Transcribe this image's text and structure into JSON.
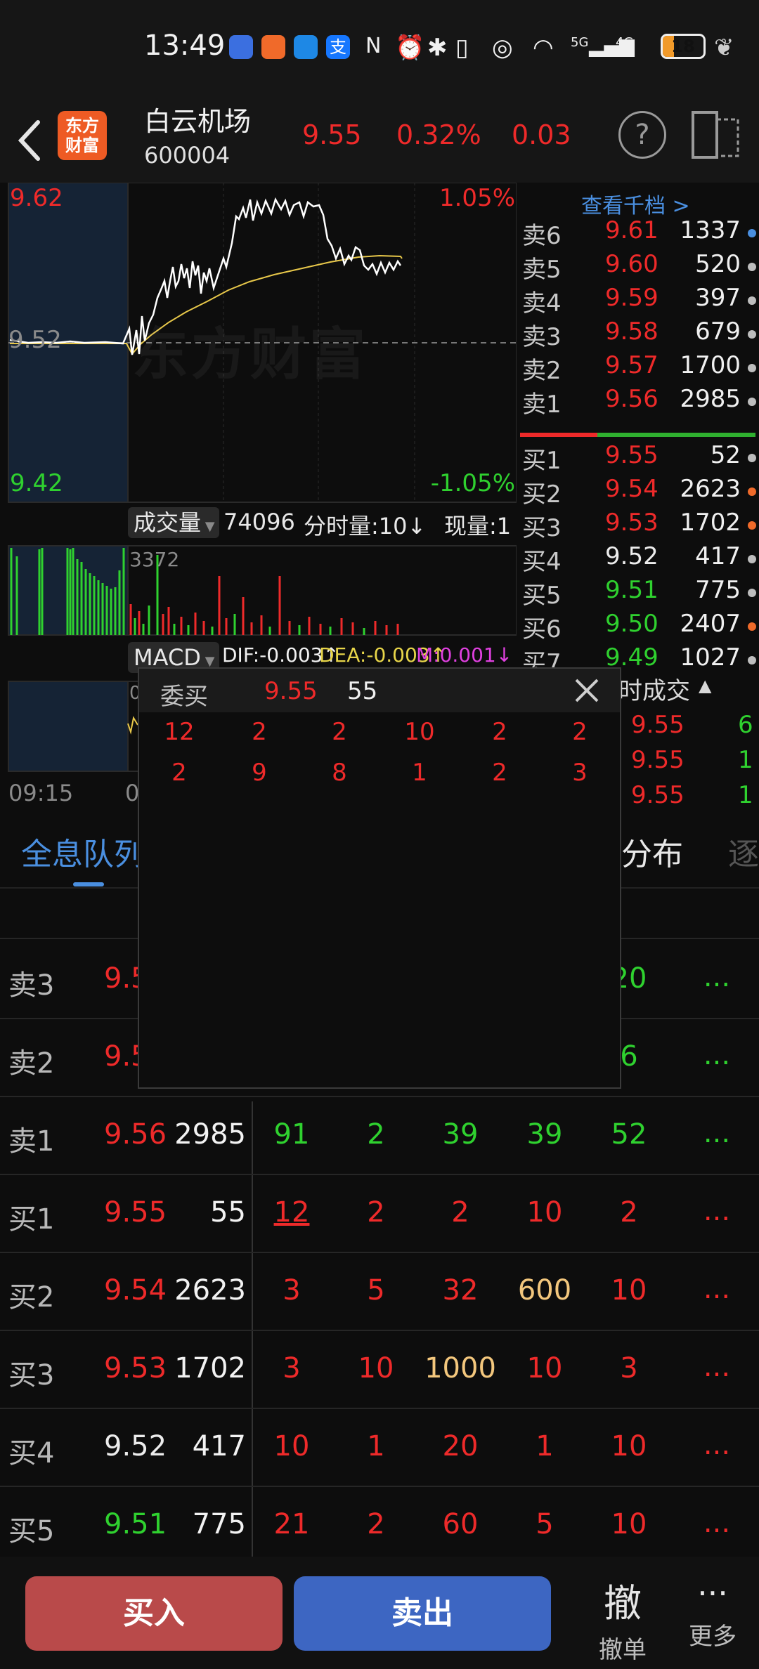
{
  "status": {
    "time": "13:49",
    "net": "5G",
    "net2": "4G",
    "battery": "18"
  },
  "header": {
    "logo_line1": "东方",
    "logo_line2": "财富",
    "name": "白云机场",
    "code": "600004",
    "price": "9.55",
    "change_pct": "0.32%",
    "change": "0.03"
  },
  "intraday": {
    "high": "9.62",
    "mid": "9.52",
    "low": "9.42",
    "high_pct": "1.05%",
    "low_pct": "-1.05%",
    "watermark": "东方财富",
    "vol_menu": "成交量",
    "vol_value": "74096",
    "vol_interval": "分时量:10↓",
    "cur_vol": "现量:1",
    "vol_max": "3372",
    "macd_menu": "MACD",
    "dif": "DIF:-0.003↑",
    "dea": "DEA:-0.003↑",
    "m": "M:0.001↓",
    "macd_tick": "0",
    "time_start": "09:15",
    "time_next": "0"
  },
  "orderbook": {
    "view_link": "查看千档 >",
    "asks": [
      {
        "label": "卖6",
        "price": "9.61",
        "vol": "1337",
        "dot": "#4a8fe0"
      },
      {
        "label": "卖5",
        "price": "9.60",
        "vol": "520",
        "dot": "#bdbdbd"
      },
      {
        "label": "卖4",
        "price": "9.59",
        "vol": "397",
        "dot": "#bdbdbd"
      },
      {
        "label": "卖3",
        "price": "9.58",
        "vol": "679",
        "dot": "#bdbdbd"
      },
      {
        "label": "卖2",
        "price": "9.57",
        "vol": "1700",
        "dot": "#bdbdbd"
      },
      {
        "label": "卖1",
        "price": "9.56",
        "vol": "2985",
        "dot": "#bdbdbd"
      }
    ],
    "bids": [
      {
        "label": "买1",
        "price": "9.55",
        "vol": "52",
        "dot": "#bdbdbd",
        "color": "red"
      },
      {
        "label": "买2",
        "price": "9.54",
        "vol": "2623",
        "dot": "#ef6a2a",
        "color": "red"
      },
      {
        "label": "买3",
        "price": "9.53",
        "vol": "1702",
        "dot": "#ef6a2a",
        "color": "red"
      },
      {
        "label": "买4",
        "price": "9.52",
        "vol": "417",
        "dot": "#bdbdbd",
        "color": "white"
      },
      {
        "label": "买5",
        "price": "9.51",
        "vol": "775",
        "dot": "#bdbdbd",
        "color": "green"
      },
      {
        "label": "买6",
        "price": "9.50",
        "vol": "2407",
        "dot": "#ef6a2a",
        "color": "green"
      },
      {
        "label": "买7",
        "price": "9.49",
        "vol": "1027",
        "dot": "#bdbdbd",
        "color": "green"
      }
    ],
    "trades_title": "时成交",
    "trades": [
      {
        "price": "9.55",
        "vol": "6"
      },
      {
        "price": "9.55",
        "vol": "1"
      },
      {
        "price": "9.55",
        "vol": "1"
      }
    ]
  },
  "popup": {
    "title": "委买",
    "price": "9.55",
    "total": "55",
    "row1": [
      "12",
      "2",
      "2",
      "10",
      "2",
      "2"
    ],
    "row2": [
      "2",
      "9",
      "8",
      "1",
      "2",
      "3"
    ]
  },
  "tabs": {
    "left": "全息队列",
    "right": "分布",
    "right_more": "逐"
  },
  "queue": [
    {
      "label": "卖3",
      "price": "9.5",
      "total": "",
      "cells": [
        "",
        "",
        "",
        "",
        "20"
      ],
      "pcolor": "red"
    },
    {
      "label": "卖2",
      "price": "9.5",
      "total": "",
      "cells": [
        "",
        "",
        "",
        "",
        "6"
      ],
      "pcolor": "red"
    },
    {
      "label": "卖1",
      "price": "9.56",
      "total": "2985",
      "cells": [
        "91",
        "2",
        "39",
        "39",
        "52"
      ],
      "pcolor": "red"
    },
    {
      "label": "买1",
      "price": "9.55",
      "total": "55",
      "cells": [
        "12",
        "2",
        "2",
        "10",
        "2"
      ],
      "pcolor": "red"
    },
    {
      "label": "买2",
      "price": "9.54",
      "total": "2623",
      "cells": [
        "3",
        "5",
        "32",
        "600",
        "10"
      ],
      "pcolor": "red"
    },
    {
      "label": "买3",
      "price": "9.53",
      "total": "1702",
      "cells": [
        "3",
        "10",
        "1000",
        "10",
        "3"
      ],
      "pcolor": "red"
    },
    {
      "label": "买4",
      "price": "9.52",
      "total": "417",
      "cells": [
        "10",
        "1",
        "20",
        "1",
        "10"
      ],
      "pcolor": "white"
    },
    {
      "label": "买5",
      "price": "9.51",
      "total": "775",
      "cells": [
        "21",
        "2",
        "60",
        "5",
        "10"
      ],
      "pcolor": "green"
    }
  ],
  "queue_more": "...",
  "footer": {
    "buy": "买入",
    "sell": "卖出",
    "cancel_icon": "撤",
    "cancel": "撤单",
    "more_icon": "···",
    "more": "更多"
  }
}
